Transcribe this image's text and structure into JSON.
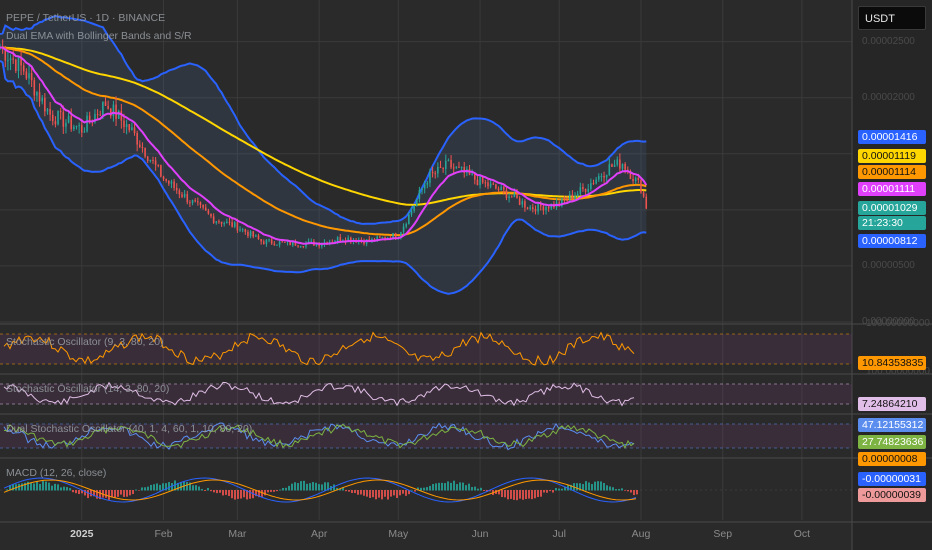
{
  "header": {
    "symbol_line": "PEPE / TetherUS · 1D · BINANCE",
    "indicator_line": "Dual EMA with Bollinger Bands and S/R"
  },
  "quote_currency_button": "USDT",
  "price_axis_ticks": [
    "0.00002500",
    "0.00002000",
    "0.00000500",
    "0.00000000"
  ],
  "price_labels": [
    {
      "text": "0.00001416",
      "bg": "#2962ff",
      "fg": "#ffffff",
      "name": "bb-upper-price-label"
    },
    {
      "text": "0.00001119",
      "bg": "#ffd600",
      "fg": "#111111",
      "name": "ema-slow-price-label"
    },
    {
      "text": "0.00001114",
      "bg": "#ff9800",
      "fg": "#111111",
      "name": "ema-mid-price-label"
    },
    {
      "text": "0.00001111",
      "bg": "#e040fb",
      "fg": "#ffffff",
      "name": "ema-fast-price-label"
    },
    {
      "text": "0.00001029",
      "bg": "#26a69a",
      "fg": "#ffffff",
      "name": "last-price-label"
    },
    {
      "text": "21:23:30",
      "bg": "#26a69a",
      "fg": "#ffffff",
      "name": "bar-countdown-label"
    },
    {
      "text": "0.00000812",
      "bg": "#2962ff",
      "fg": "#ffffff",
      "name": "bb-lower-price-label"
    }
  ],
  "indicators": {
    "stoch1": {
      "title": "Stochastic Oscillator (9, 3, 80, 20)",
      "value": "10.84353835",
      "color": "#ff9800",
      "axis_top": "100.00000000"
    },
    "stoch2": {
      "title": "Stochastic Oscillator (14, 3, 80, 20)",
      "value": "7.24864210",
      "color": "#e1bee7",
      "axis_top": "100.00000000"
    },
    "dual_stoch": {
      "title": "Dual Stochastic Oscillator (40, 1, 4, 60, 1, 10, 80, 20)",
      "value1": "47.12155312",
      "value2": "27.74823636",
      "color1": "#5b8def",
      "color2": "#7cb342"
    },
    "macd": {
      "title": "MACD (12, 26, close)",
      "values": [
        "0.00000008",
        "-0.00000031",
        "-0.00000039"
      ],
      "colors": [
        "#ff9800",
        "#2962ff",
        "#ef9a9a"
      ]
    }
  },
  "time_axis": [
    "2025",
    "Feb",
    "Mar",
    "Apr",
    "May",
    "Jun",
    "Jul",
    "Aug",
    "Sep",
    "Oct"
  ],
  "colors": {
    "background": "#2a2a2a",
    "up_candle": "#26a69a",
    "down_candle": "#ef5350",
    "bollinger": "#2962ff",
    "ema_fast": "#e040fb",
    "ema_mid": "#ff9800",
    "ema_slow": "#ffd600"
  },
  "chart_data": {
    "type": "candlestick",
    "title": "PEPE / TetherUS · 1D · BINANCE",
    "y_unit": "USDT",
    "ylim": [
      0,
      2.8e-05
    ],
    "x_range": [
      "2024-12-01",
      "2025-10-20"
    ],
    "series": [
      {
        "name": "PEPE/USDT close",
        "x": [
          "2024-12-01",
          "2024-12-10",
          "2024-12-20",
          "2025-01-01",
          "2025-01-10",
          "2025-01-20",
          "2025-02-01",
          "2025-02-10",
          "2025-02-20",
          "2025-03-01",
          "2025-03-10",
          "2025-03-20",
          "2025-04-01",
          "2025-04-10",
          "2025-04-20",
          "2025-05-01",
          "2025-05-05",
          "2025-05-12",
          "2025-05-20",
          "2025-06-01",
          "2025-06-10",
          "2025-06-20",
          "2025-07-01",
          "2025-07-10",
          "2025-07-20",
          "2025-07-25",
          "2025-08-01",
          "2025-08-03"
        ],
        "values": [
          2.45e-05,
          2.25e-05,
          1.85e-05,
          1.72e-05,
          1.95e-05,
          1.7e-05,
          1.28e-05,
          1.1e-05,
          9.2e-06,
          8.5e-06,
          7.2e-06,
          7e-06,
          7e-06,
          7.5e-06,
          7.2e-06,
          7.8e-06,
          9.5e-06,
          1.28e-05,
          1.4e-05,
          1.25e-05,
          1.16e-05,
          1.02e-05,
          1.05e-05,
          1.18e-05,
          1.38e-05,
          1.42e-05,
          1.2e-05,
          1.03e-05
        ]
      }
    ],
    "overlays": [
      "Bollinger Bands upper",
      "Bollinger Bands lower",
      "EMA fast",
      "EMA mid",
      "EMA slow"
    ],
    "last_values": {
      "bb_upper": 1.416e-05,
      "ema_slow": 1.119e-05,
      "ema_mid": 1.114e-05,
      "ema_fast": 1.111e-05,
      "close": 1.029e-05,
      "bb_lower": 8.12e-06
    },
    "grid": true
  }
}
